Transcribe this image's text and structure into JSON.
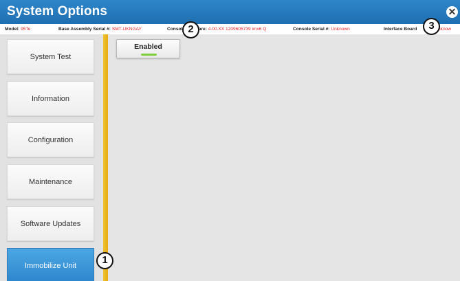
{
  "window": {
    "title": "System Options",
    "close_glyph": "✕"
  },
  "info_bar": [
    {
      "label": "Model:",
      "value": "95Te"
    },
    {
      "label": "Base Assembly Serial #:",
      "value": "SMT-UKNGAY"
    },
    {
      "label": "Console Software:",
      "value": "4.00.XX 1209605739 imx6 Q"
    },
    {
      "label": "Console Serial #:",
      "value": "Unknown"
    },
    {
      "label": "Interface Board",
      "value": "Unknow"
    }
  ],
  "sidebar": {
    "items": [
      {
        "label": "System Test",
        "active": false
      },
      {
        "label": "Information",
        "active": false
      },
      {
        "label": "Configuration",
        "active": false
      },
      {
        "label": "Maintenance",
        "active": false
      },
      {
        "label": "Software Updates",
        "active": false
      },
      {
        "label": "Immobilize Unit",
        "active": true
      }
    ]
  },
  "main": {
    "toggle_label": "Enabled",
    "toggle_on": true
  },
  "callouts": [
    "1",
    "2",
    "3"
  ],
  "colors": {
    "titlebar": "#1e6fb2",
    "accent_divider": "#f1c232",
    "active_nav": "#2d86cc",
    "info_value": "#e0262a",
    "indicator_on": "#7ecf3a"
  }
}
